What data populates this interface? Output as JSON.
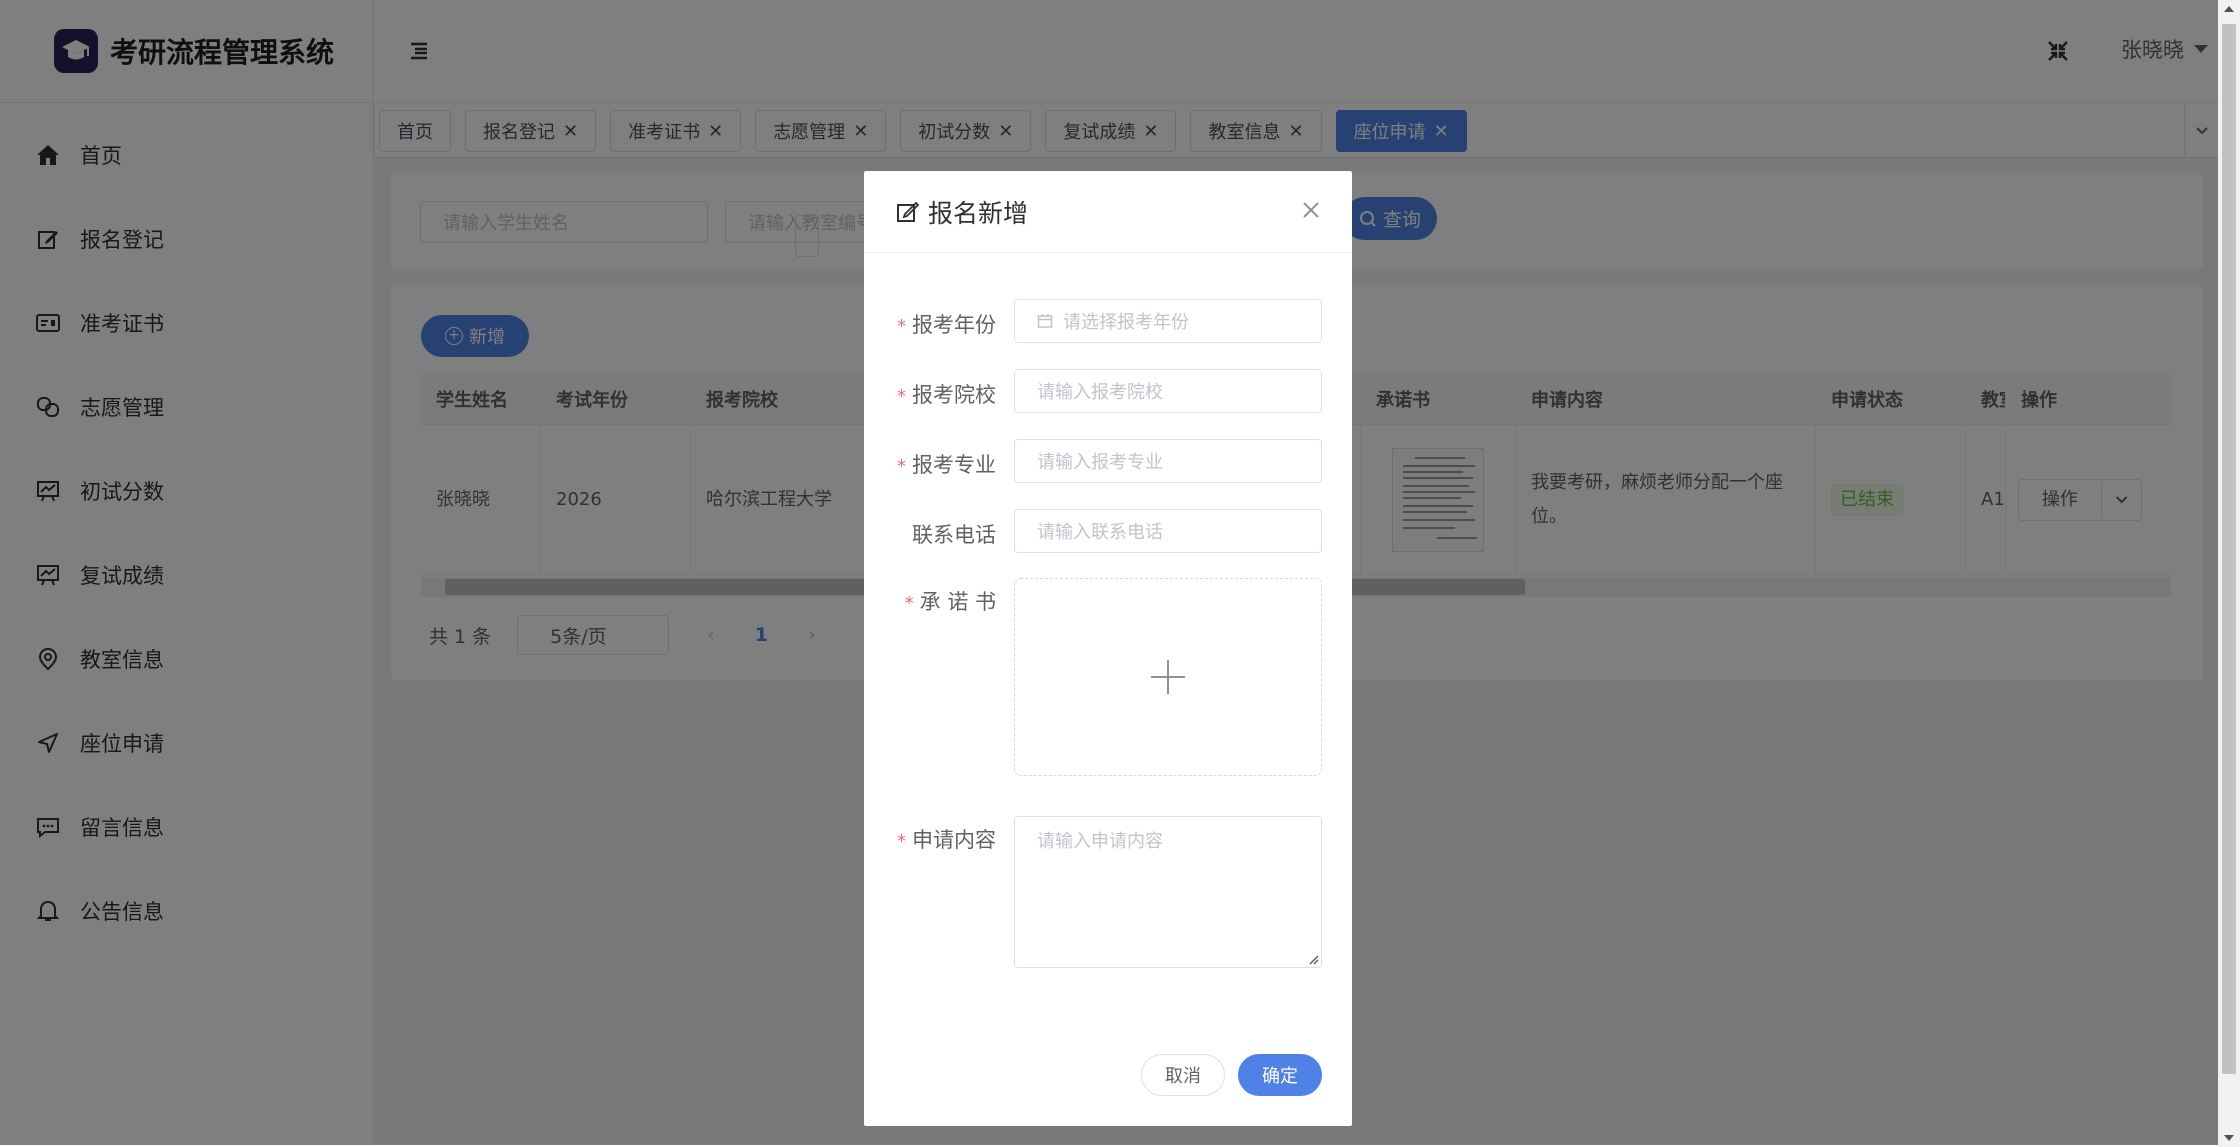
{
  "app": {
    "title": "考研流程管理系统"
  },
  "sidebar": {
    "items": [
      {
        "label": "首页",
        "icon": "home-icon"
      },
      {
        "label": "报名登记",
        "icon": "edit-icon"
      },
      {
        "label": "准考证书",
        "icon": "id-card-icon"
      },
      {
        "label": "志愿管理",
        "icon": "link-icon"
      },
      {
        "label": "初试分数",
        "icon": "chart-icon"
      },
      {
        "label": "复试成绩",
        "icon": "chart-icon"
      },
      {
        "label": "教室信息",
        "icon": "location-icon"
      },
      {
        "label": "座位申请",
        "icon": "send-icon"
      },
      {
        "label": "留言信息",
        "icon": "message-icon"
      },
      {
        "label": "公告信息",
        "icon": "bell-icon"
      }
    ]
  },
  "header": {
    "user": "张晓晓"
  },
  "tags": [
    {
      "label": "首页",
      "closable": false
    },
    {
      "label": "报名登记",
      "closable": true
    },
    {
      "label": "准考证书",
      "closable": true
    },
    {
      "label": "志愿管理",
      "closable": true
    },
    {
      "label": "初试分数",
      "closable": true
    },
    {
      "label": "复试成绩",
      "closable": true
    },
    {
      "label": "教室信息",
      "closable": true
    },
    {
      "label": "座位申请",
      "closable": true,
      "active": true
    }
  ],
  "search": {
    "student_placeholder": "请输入学生姓名",
    "classroom_placeholder": "请输入教室编号",
    "query_label": "查询"
  },
  "table": {
    "add_label": "新增",
    "columns": [
      "学生姓名",
      "考试年份",
      "报考院校",
      "承诺书",
      "申请内容",
      "申请状态",
      "教室",
      "操作"
    ],
    "rows": [
      {
        "student": "张晓晓",
        "year": "2026",
        "school": "哈尔滨工程大学",
        "content": "我要考研，麻烦老师分配一个座位。",
        "status": "已结束",
        "classroom": "A1",
        "op_label": "操作"
      }
    ]
  },
  "pager": {
    "total": "共 1 条",
    "page_size": "5条/页",
    "current": "1"
  },
  "dialog": {
    "title": "报名新增",
    "fields": {
      "year": {
        "label": "报考年份",
        "placeholder": "请选择报考年份"
      },
      "school": {
        "label": "报考院校",
        "placeholder": "请输入报考院校"
      },
      "major": {
        "label": "报考专业",
        "placeholder": "请输入报考专业"
      },
      "phone": {
        "label": "联系电话",
        "placeholder": "请输入联系电话"
      },
      "letter": {
        "label": "承 诺 书"
      },
      "content": {
        "label": "申请内容",
        "placeholder": "请输入申请内容"
      }
    },
    "cancel_label": "取消",
    "confirm_label": "确定"
  },
  "colors": {
    "primary": "#4e82e6",
    "required": "#f56c6c",
    "success": "#67c23a",
    "logo_bg": "#28235a"
  }
}
